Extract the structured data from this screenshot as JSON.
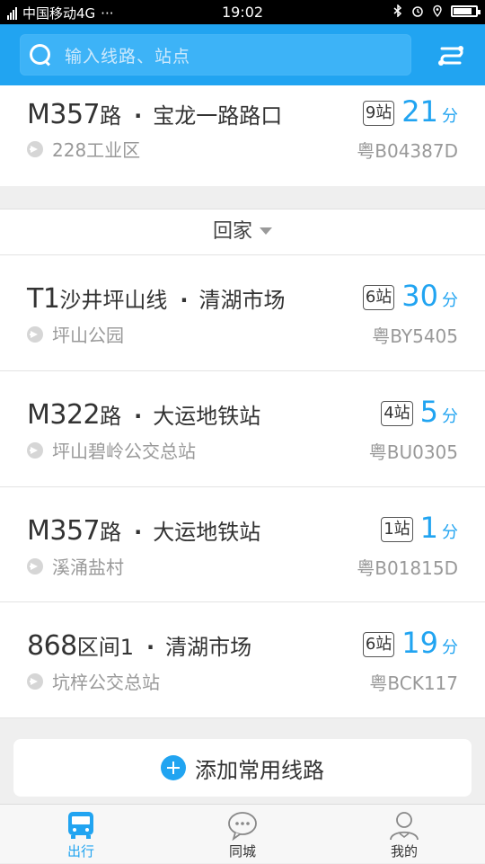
{
  "status_bar": {
    "carrier": "中国移动4G",
    "dots": "···",
    "time": "19:02"
  },
  "search": {
    "placeholder": "输入线路、站点"
  },
  "top_card": {
    "route": "M357",
    "suffix": "路",
    "stop": "宝龙一路路口",
    "stops": "9站",
    "minutes": "21",
    "unit": "分",
    "from": "228工业区",
    "plate": "粤B04387D"
  },
  "group": {
    "label": "回家"
  },
  "rows": [
    {
      "route": "T1",
      "suffix": "沙井坪山线",
      "stop": "清湖市场",
      "stops": "6站",
      "minutes": "30",
      "unit": "分",
      "from": "坪山公园",
      "plate": "粤BY5405"
    },
    {
      "route": "M322",
      "suffix": "路",
      "stop": "大运地铁站",
      "stops": "4站",
      "minutes": "5",
      "unit": "分",
      "from": "坪山碧岭公交总站",
      "plate": "粤BU0305"
    },
    {
      "route": "M357",
      "suffix": "路",
      "stop": "大运地铁站",
      "stops": "1站",
      "minutes": "1",
      "unit": "分",
      "from": "溪涌盐村",
      "plate": "粤B01815D"
    },
    {
      "route": "868",
      "suffix": "区间1",
      "stop": "清湖市场",
      "stops": "6站",
      "minutes": "19",
      "unit": "分",
      "from": "坑梓公交总站",
      "plate": "粤BCK117"
    }
  ],
  "add_route": {
    "label": "添加常用线路"
  },
  "tabs": [
    {
      "label": "出行",
      "icon": "bus-icon",
      "active": true
    },
    {
      "label": "同城",
      "icon": "chat-icon",
      "active": false
    },
    {
      "label": "我的",
      "icon": "user-icon",
      "active": false
    }
  ],
  "colors": {
    "accent": "#21a4f1",
    "header": "#21a4f1"
  }
}
